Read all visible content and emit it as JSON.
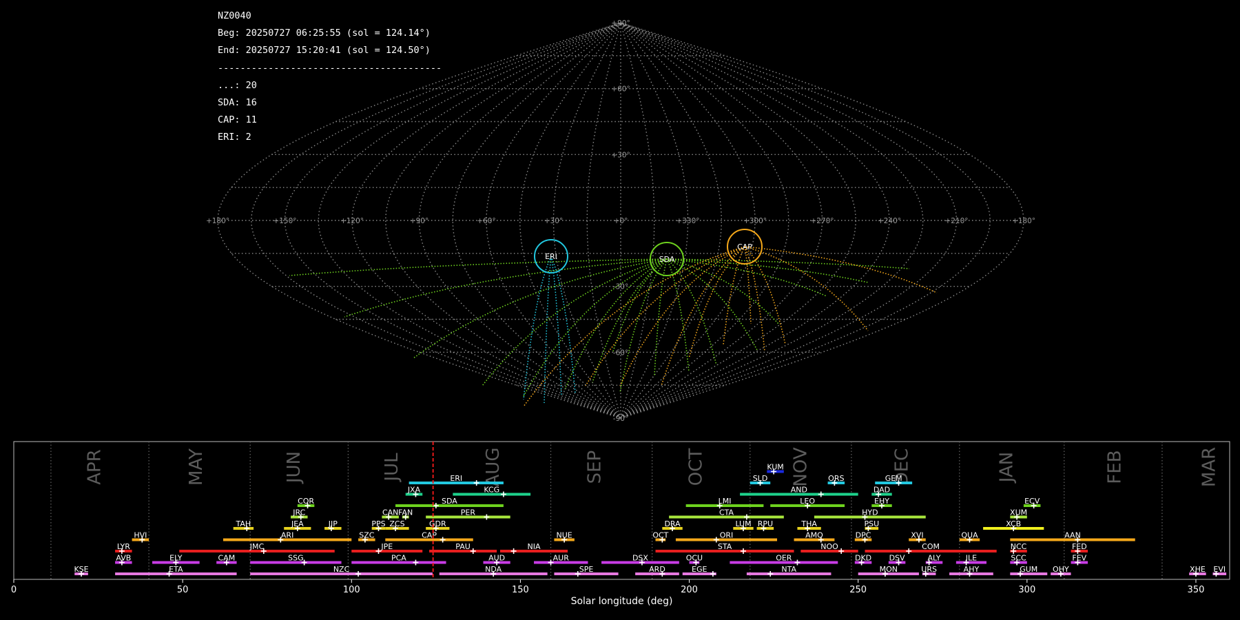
{
  "info": {
    "lines": [
      "NZ0040",
      "Beg: 20250727 06:25:55 (sol = 124.14°)",
      "End: 20250727 15:20:41 (sol = 124.50°)",
      "----------------------------------------",
      "...: 20",
      "SDA: 16",
      "CAP: 11",
      "ERI: 2"
    ]
  },
  "sky_map": {
    "projection": "sinusoidal",
    "lon_labels": [
      "+180°",
      "+150°",
      "+120°",
      "+90°",
      "+60°",
      "+30°",
      "+0°",
      "+330°",
      "+300°",
      "+270°",
      "+240°",
      "+210°",
      "+180°"
    ],
    "lat_labels": [
      "+90°",
      "+60°",
      "+30°",
      "-30°",
      "-60°",
      "-90°"
    ],
    "radiants": [
      {
        "code": "ERI",
        "color": "#22c8e0"
      },
      {
        "code": "SDA",
        "color": "#6ed21e"
      },
      {
        "code": "CAP",
        "color": "#f5a81a"
      }
    ]
  },
  "chart_data": {
    "type": "timeline",
    "xlabel": "Solar longitude (deg)",
    "xlim": [
      0,
      360
    ],
    "xticks": [
      0,
      50,
      100,
      150,
      200,
      250,
      300,
      350
    ],
    "current_sol": 124.14,
    "months": [
      {
        "label": "APR",
        "sol": 24
      },
      {
        "label": "MAY",
        "sol": 54
      },
      {
        "label": "JUN",
        "sol": 83
      },
      {
        "label": "JUL",
        "sol": 112
      },
      {
        "label": "AUG",
        "sol": 142
      },
      {
        "label": "SEP",
        "sol": 172
      },
      {
        "label": "OCT",
        "sol": 202
      },
      {
        "label": "NOV",
        "sol": 233
      },
      {
        "label": "DEC",
        "sol": 263
      },
      {
        "label": "JAN",
        "sol": 294
      },
      {
        "label": "FEB",
        "sol": 326
      },
      {
        "label": "MAR",
        "sol": 354
      }
    ],
    "month_boundaries": [
      11,
      40,
      70,
      99,
      159,
      189,
      218,
      248,
      280,
      311,
      340
    ],
    "showers": [
      {
        "code": "KUM",
        "start": 223,
        "end": 228,
        "peak": 225,
        "row": 9,
        "color": "#1a2ae0"
      },
      {
        "code": "ERI",
        "start": 117,
        "end": 145,
        "peak": 137,
        "row": 8,
        "color": "#22c8e0"
      },
      {
        "code": "SLD",
        "start": 218,
        "end": 224,
        "peak": 221,
        "row": 8,
        "color": "#22c8e0"
      },
      {
        "code": "ORS",
        "start": 241,
        "end": 246,
        "peak": 243,
        "row": 8,
        "color": "#22c8e0"
      },
      {
        "code": "GEM",
        "start": 255,
        "end": 266,
        "peak": 262,
        "row": 8,
        "color": "#22c8e0"
      },
      {
        "code": "JXA",
        "start": 116,
        "end": 121,
        "peak": 119,
        "row": 7,
        "color": "#1ed28c"
      },
      {
        "code": "KCG",
        "start": 130,
        "end": 153,
        "peak": 145,
        "row": 7,
        "color": "#1ed28c"
      },
      {
        "code": "AND",
        "start": 215,
        "end": 250,
        "peak": 239,
        "row": 7,
        "color": "#1ed28c"
      },
      {
        "code": "DAD",
        "start": 254,
        "end": 260,
        "peak": 256,
        "row": 7,
        "color": "#1ed28c"
      },
      {
        "code": "COR",
        "start": 84,
        "end": 89,
        "peak": 87,
        "row": 6,
        "color": "#6ed21e"
      },
      {
        "code": "SDA",
        "start": 113,
        "end": 145,
        "peak": 125,
        "row": 6,
        "color": "#6ed21e"
      },
      {
        "code": "LMI",
        "start": 199,
        "end": 222,
        "peak": 209,
        "row": 6,
        "color": "#6ed21e"
      },
      {
        "code": "LEO",
        "start": 224,
        "end": 246,
        "peak": 235,
        "row": 6,
        "color": "#6ed21e"
      },
      {
        "code": "EHY",
        "start": 254,
        "end": 260,
        "peak": 257,
        "row": 6,
        "color": "#6ed21e"
      },
      {
        "code": "ECV",
        "start": 299,
        "end": 304,
        "peak": 302,
        "row": 6,
        "color": "#6ed21e"
      },
      {
        "code": "JRC",
        "start": 82,
        "end": 87,
        "peak": 85,
        "row": 5,
        "color": "#a8e63c"
      },
      {
        "code": "CAN",
        "start": 109,
        "end": 114,
        "peak": 111,
        "row": 5,
        "color": "#a8e63c"
      },
      {
        "code": "FAN",
        "start": 115,
        "end": 117,
        "peak": 116,
        "row": 5,
        "color": "#a8e63c"
      },
      {
        "code": "PER",
        "start": 122,
        "end": 147,
        "peak": 140,
        "row": 5,
        "color": "#a8e63c"
      },
      {
        "code": "CTA",
        "start": 194,
        "end": 228,
        "peak": 217,
        "row": 5,
        "color": "#a8e63c"
      },
      {
        "code": "HYD",
        "start": 237,
        "end": 270,
        "peak": 252,
        "row": 5,
        "color": "#a8e63c"
      },
      {
        "code": "XUM",
        "start": 295,
        "end": 300,
        "peak": 297,
        "row": 5,
        "color": "#a8e63c"
      },
      {
        "code": "TAH",
        "start": 65,
        "end": 71,
        "peak": 69,
        "row": 4,
        "color": "#e6d21e"
      },
      {
        "code": "JEA",
        "start": 80,
        "end": 88,
        "peak": 84,
        "row": 4,
        "color": "#e6d21e"
      },
      {
        "code": "JIP",
        "start": 92,
        "end": 97,
        "peak": 94,
        "row": 4,
        "color": "#e6d21e"
      },
      {
        "code": "PPS",
        "start": 106,
        "end": 110,
        "peak": 108,
        "row": 4,
        "color": "#e6d21e"
      },
      {
        "code": "ZCS",
        "start": 110,
        "end": 117,
        "peak": 113,
        "row": 4,
        "color": "#e6d21e"
      },
      {
        "code": "GDR",
        "start": 122,
        "end": 129,
        "peak": 125,
        "row": 4,
        "color": "#e6d21e"
      },
      {
        "code": "DRA",
        "start": 192,
        "end": 198,
        "peak": 195,
        "row": 4,
        "color": "#e6d21e"
      },
      {
        "code": "LUM",
        "start": 213,
        "end": 219,
        "peak": 216,
        "row": 4,
        "color": "#e6d21e"
      },
      {
        "code": "RPU",
        "start": 220,
        "end": 225,
        "peak": 222,
        "row": 4,
        "color": "#e6d21e"
      },
      {
        "code": "THA",
        "start": 232,
        "end": 239,
        "peak": 235,
        "row": 4,
        "color": "#e6d21e"
      },
      {
        "code": "PSU",
        "start": 252,
        "end": 256,
        "peak": 253,
        "row": 4,
        "color": "#e6d21e"
      },
      {
        "code": "XCB",
        "start": 287,
        "end": 305,
        "peak": 296,
        "row": 4,
        "color": "#f0f01e"
      },
      {
        "code": "HVI",
        "start": 35,
        "end": 40,
        "peak": 38,
        "row": 3,
        "color": "#f5a81a"
      },
      {
        "code": "ARI",
        "start": 62,
        "end": 100,
        "peak": 79,
        "row": 3,
        "color": "#f5a81a"
      },
      {
        "code": "SZC",
        "start": 102,
        "end": 107,
        "peak": 104,
        "row": 3,
        "color": "#f5a81a"
      },
      {
        "code": "CAP",
        "start": 110,
        "end": 136,
        "peak": 127,
        "row": 3,
        "color": "#f5a81a"
      },
      {
        "code": "NUE",
        "start": 160,
        "end": 166,
        "peak": 163,
        "row": 3,
        "color": "#f5a81a"
      },
      {
        "code": "OCT",
        "start": 190,
        "end": 193,
        "peak": 192,
        "row": 3,
        "color": "#f5a81a"
      },
      {
        "code": "ORI",
        "start": 196,
        "end": 226,
        "peak": 208,
        "row": 3,
        "color": "#f5a81a"
      },
      {
        "code": "AMO",
        "start": 231,
        "end": 243,
        "peak": 239,
        "row": 3,
        "color": "#f5a81a"
      },
      {
        "code": "DPC",
        "start": 249,
        "end": 254,
        "peak": 252,
        "row": 3,
        "color": "#f5a81a"
      },
      {
        "code": "XVI",
        "start": 265,
        "end": 270,
        "peak": 268,
        "row": 3,
        "color": "#f5a81a"
      },
      {
        "code": "QUA",
        "start": 280,
        "end": 286,
        "peak": 283,
        "row": 3,
        "color": "#f5a81a"
      },
      {
        "code": "AAN",
        "start": 295,
        "end": 332,
        "peak": 315,
        "row": 3,
        "color": "#f5a81a"
      },
      {
        "code": "LYR",
        "start": 30,
        "end": 35,
        "peak": 32,
        "row": 2,
        "color": "#e61e1e"
      },
      {
        "code": "JMC",
        "start": 49,
        "end": 95,
        "peak": 74,
        "row": 2,
        "color": "#e61e1e"
      },
      {
        "code": "JPE",
        "start": 100,
        "end": 121,
        "peak": 108,
        "row": 2,
        "color": "#e61e1e"
      },
      {
        "code": "PAU",
        "start": 123,
        "end": 143,
        "peak": 136,
        "row": 2,
        "color": "#e61e1e"
      },
      {
        "code": "NIA",
        "start": 144,
        "end": 164,
        "peak": 148,
        "row": 2,
        "color": "#e61e1e"
      },
      {
        "code": "STA",
        "start": 190,
        "end": 231,
        "peak": 216,
        "row": 2,
        "color": "#e61e1e"
      },
      {
        "code": "NOO",
        "start": 233,
        "end": 250,
        "peak": 245,
        "row": 2,
        "color": "#e61e1e"
      },
      {
        "code": "COM",
        "start": 252,
        "end": 291,
        "peak": 265,
        "row": 2,
        "color": "#e61e1e"
      },
      {
        "code": "NCC",
        "start": 295,
        "end": 300,
        "peak": 296,
        "row": 2,
        "color": "#e61e1e"
      },
      {
        "code": "FED",
        "start": 313,
        "end": 318,
        "peak": 315,
        "row": 2,
        "color": "#e61e1e"
      },
      {
        "code": "AVB",
        "start": 30,
        "end": 35,
        "peak": 32,
        "row": 1,
        "color": "#c83ce6"
      },
      {
        "code": "ELY",
        "start": 41,
        "end": 55,
        "peak": 48,
        "row": 1,
        "color": "#c83ce6"
      },
      {
        "code": "CAM",
        "start": 60,
        "end": 66,
        "peak": 63,
        "row": 1,
        "color": "#c83ce6"
      },
      {
        "code": "SSG",
        "start": 70,
        "end": 97,
        "peak": 86,
        "row": 1,
        "color": "#c83ce6"
      },
      {
        "code": "PCA",
        "start": 100,
        "end": 128,
        "peak": 119,
        "row": 1,
        "color": "#c83ce6"
      },
      {
        "code": "AUD",
        "start": 139,
        "end": 147,
        "peak": 143,
        "row": 1,
        "color": "#c83ce6"
      },
      {
        "code": "AUR",
        "start": 154,
        "end": 170,
        "peak": 159,
        "row": 1,
        "color": "#c83ce6"
      },
      {
        "code": "DSX",
        "start": 174,
        "end": 197,
        "peak": 186,
        "row": 1,
        "color": "#c83ce6"
      },
      {
        "code": "OCU",
        "start": 200,
        "end": 203,
        "peak": 202,
        "row": 1,
        "color": "#c83ce6"
      },
      {
        "code": "OER",
        "start": 212,
        "end": 244,
        "peak": 232,
        "row": 1,
        "color": "#c83ce6"
      },
      {
        "code": "DKD",
        "start": 249,
        "end": 254,
        "peak": 251,
        "row": 1,
        "color": "#c83ce6"
      },
      {
        "code": "DSV",
        "start": 259,
        "end": 264,
        "peak": 262,
        "row": 1,
        "color": "#c83ce6"
      },
      {
        "code": "ALY",
        "start": 270,
        "end": 275,
        "peak": 271,
        "row": 1,
        "color": "#c83ce6"
      },
      {
        "code": "ILE",
        "start": 279,
        "end": 288,
        "peak": 282,
        "row": 1,
        "color": "#c83ce6"
      },
      {
        "code": "SCC",
        "start": 295,
        "end": 300,
        "peak": 297,
        "row": 1,
        "color": "#c83ce6"
      },
      {
        "code": "FEV",
        "start": 313,
        "end": 318,
        "peak": 315,
        "row": 1,
        "color": "#c83ce6"
      },
      {
        "code": "KSE",
        "start": 18,
        "end": 22,
        "peak": 20,
        "row": 0,
        "color": "#e678e0"
      },
      {
        "code": "ETA",
        "start": 30,
        "end": 66,
        "peak": 46,
        "row": 0,
        "color": "#e678e0"
      },
      {
        "code": "NZC",
        "start": 70,
        "end": 124,
        "peak": 102,
        "row": 0,
        "color": "#e678e0"
      },
      {
        "code": "NDA",
        "start": 126,
        "end": 158,
        "peak": 142,
        "row": 0,
        "color": "#e678e0"
      },
      {
        "code": "SPE",
        "start": 160,
        "end": 179,
        "peak": 167,
        "row": 0,
        "color": "#e678e0"
      },
      {
        "code": "ARD",
        "start": 184,
        "end": 197,
        "peak": 192,
        "row": 0,
        "color": "#e678e0"
      },
      {
        "code": "EGE",
        "start": 198,
        "end": 208,
        "peak": 207,
        "row": 0,
        "color": "#e678e0"
      },
      {
        "code": "NTA",
        "start": 217,
        "end": 242,
        "peak": 224,
        "row": 0,
        "color": "#e678e0"
      },
      {
        "code": "MON",
        "start": 250,
        "end": 268,
        "peak": 258,
        "row": 0,
        "color": "#e678e0"
      },
      {
        "code": "URS",
        "start": 269,
        "end": 273,
        "peak": 270,
        "row": 0,
        "color": "#e678e0"
      },
      {
        "code": "AHY",
        "start": 277,
        "end": 290,
        "peak": 283,
        "row": 0,
        "color": "#e678e0"
      },
      {
        "code": "GUM",
        "start": 295,
        "end": 306,
        "peak": 298,
        "row": 0,
        "color": "#e678e0"
      },
      {
        "code": "OHY",
        "start": 307,
        "end": 313,
        "peak": 310,
        "row": 0,
        "color": "#e678e0"
      },
      {
        "code": "XHE",
        "start": 348,
        "end": 353,
        "peak": 350,
        "row": 0,
        "color": "#e678e0"
      },
      {
        "code": "EVI",
        "start": 355,
        "end": 359,
        "peak": 356,
        "row": 0,
        "color": "#e678e0"
      }
    ]
  }
}
